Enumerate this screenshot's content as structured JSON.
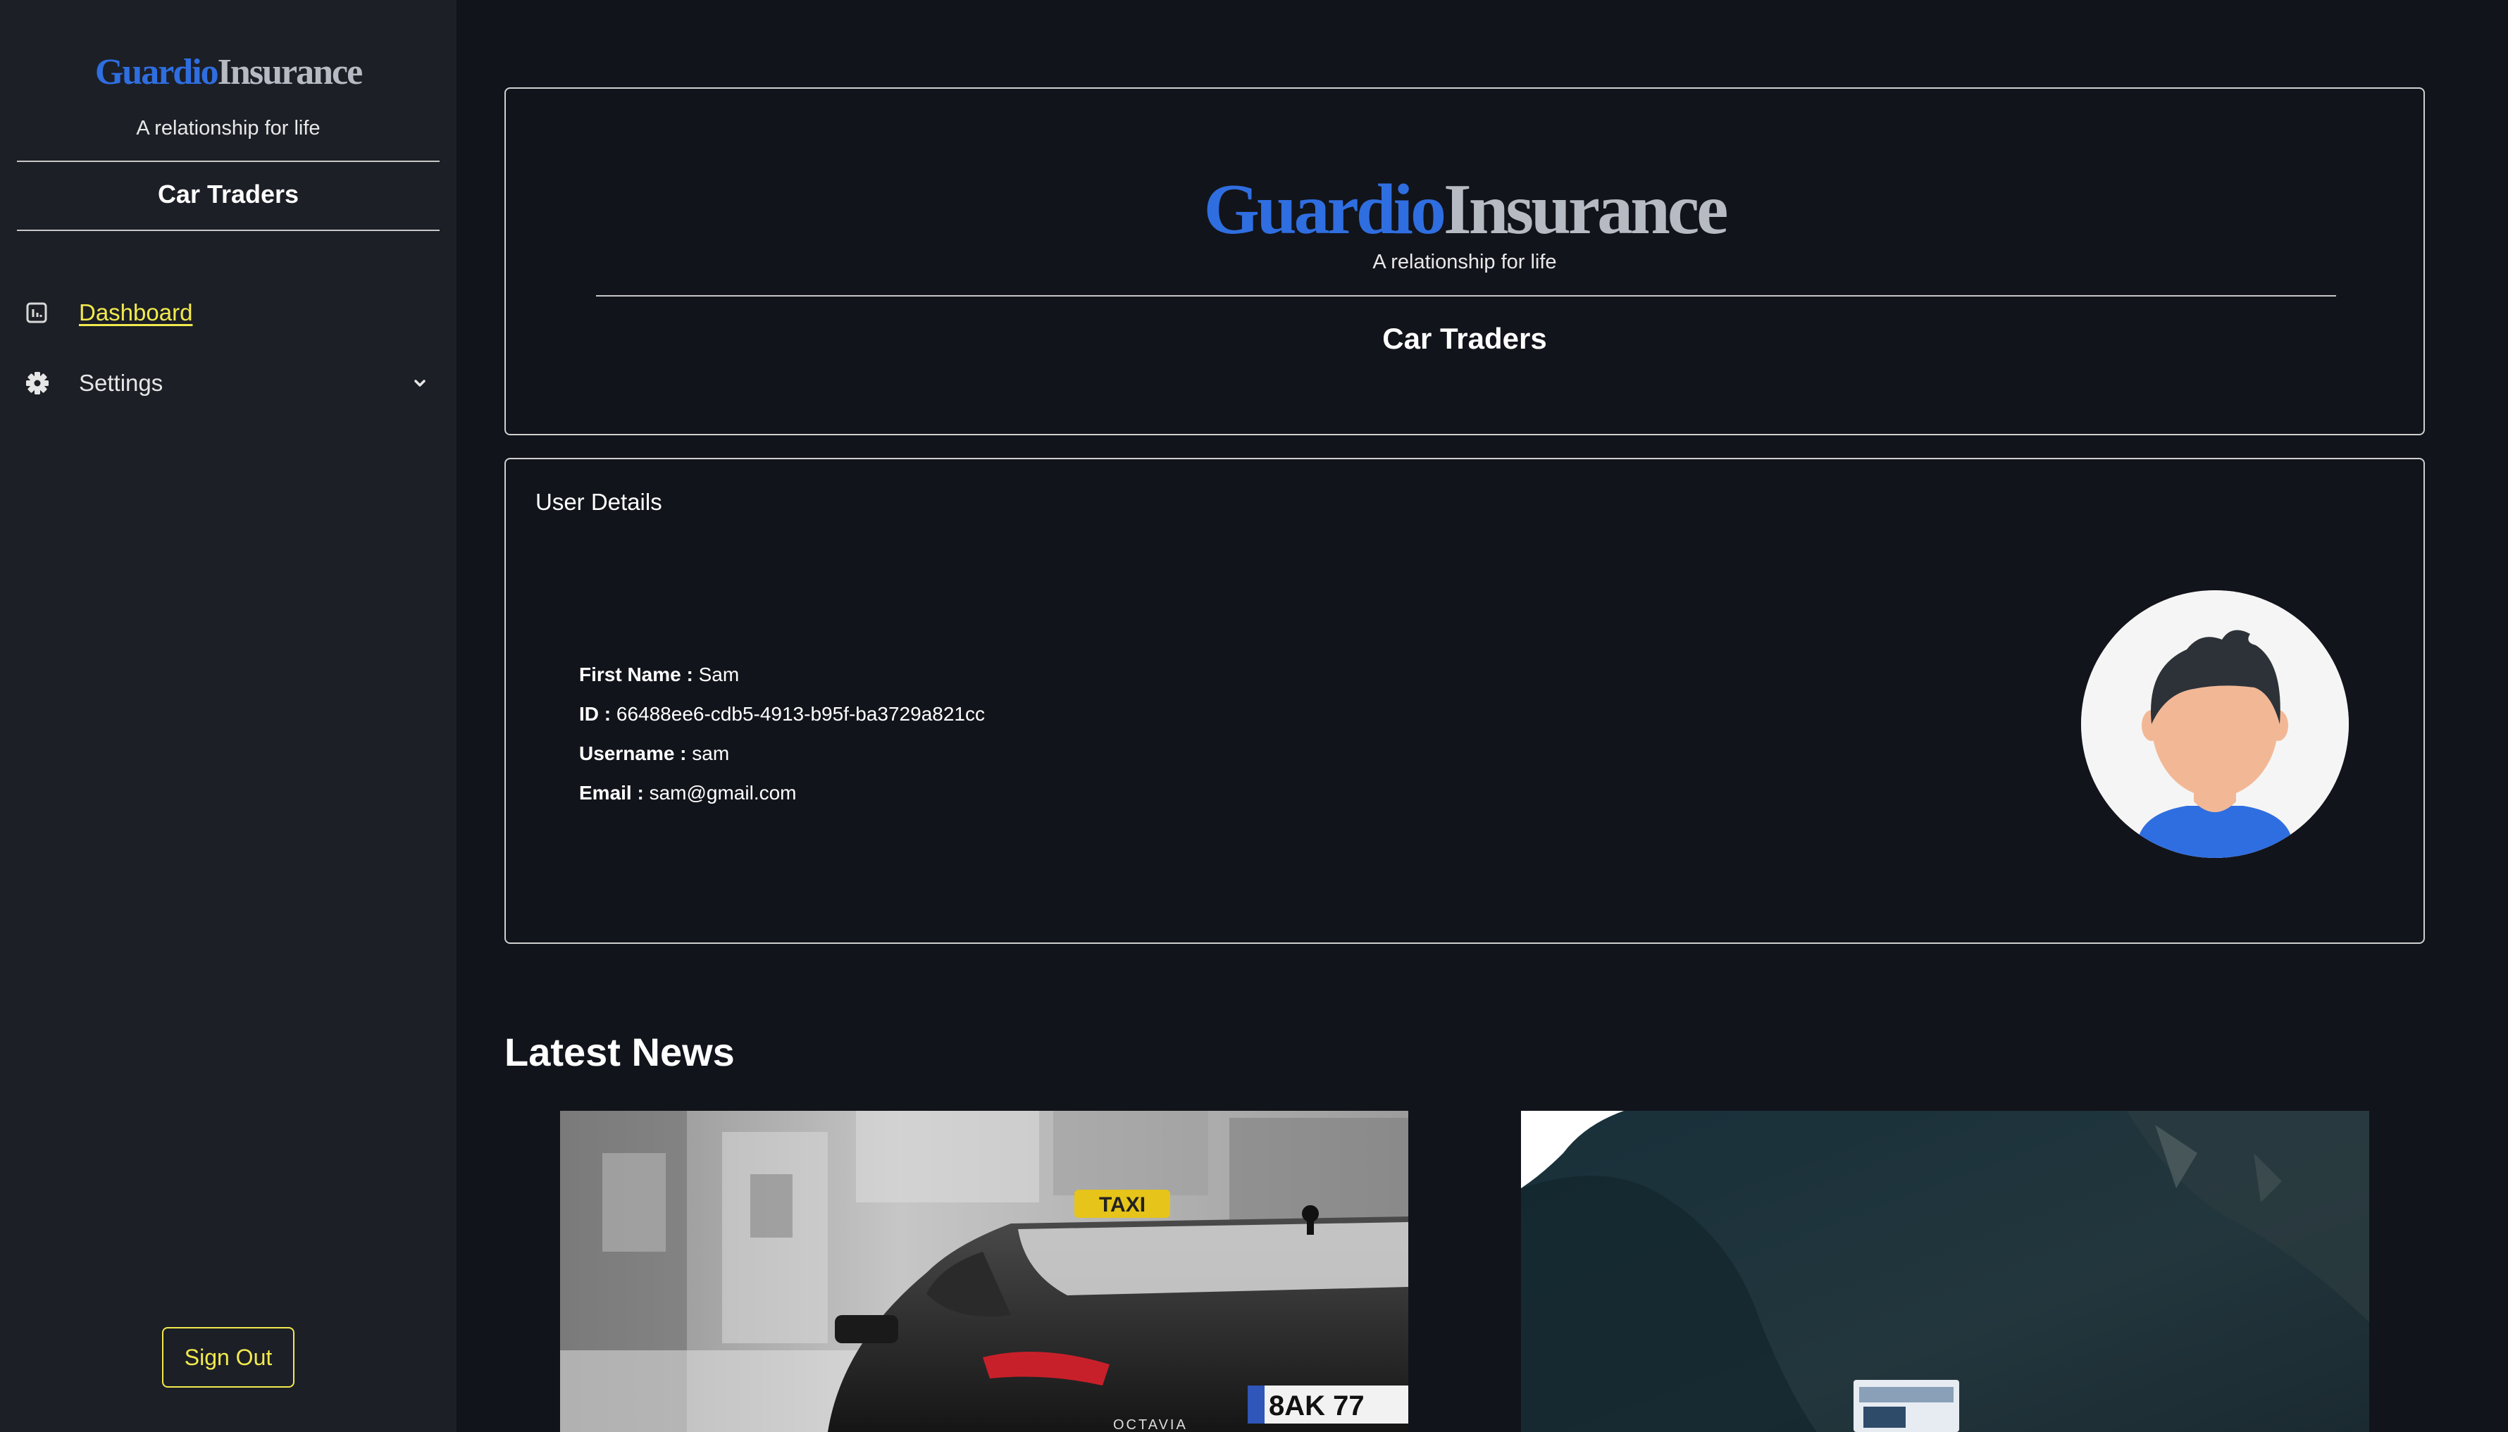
{
  "brand": {
    "name_part1": "Guardio",
    "name_part2": "Insurance",
    "tagline": "A relationship for life",
    "company": "Car Traders",
    "colors": {
      "primary": "#2f6ee0",
      "secondary": "#b6bac3",
      "accent": "#f2e94e"
    }
  },
  "sidebar": {
    "nav": [
      {
        "label": "Dashboard",
        "icon": "chart-icon",
        "active": true
      },
      {
        "label": "Settings",
        "icon": "gear-icon",
        "expandable": true
      }
    ],
    "sign_out": "Sign Out"
  },
  "user_details": {
    "title": "User Details",
    "fields": [
      {
        "label": "First Name :",
        "value": "Sam"
      },
      {
        "label": "ID :",
        "value": "66488ee6-cdb5-4913-b95f-ba3729a821cc"
      },
      {
        "label": "Username :",
        "value": "sam"
      },
      {
        "label": "Email :",
        "value": "sam@gmail.com"
      }
    ],
    "avatar_icon": "user-avatar-icon"
  },
  "news": {
    "heading": "Latest News",
    "images": [
      {
        "name": "taxi-photo",
        "sign_text": "TAXI",
        "plate_text": "8AK 77",
        "model_text": "OCTAVIA"
      },
      {
        "name": "mountain-truck-photo"
      }
    ]
  }
}
